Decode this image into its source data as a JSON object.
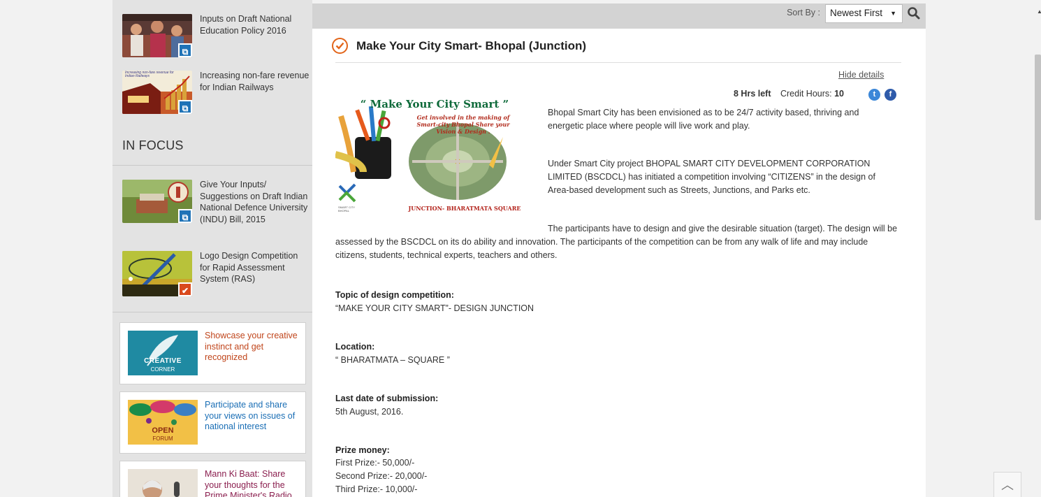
{
  "sidebar": {
    "items_top": [
      {
        "label": "Inputs on Draft National Education Policy 2016"
      },
      {
        "label": "Increasing non-fare revenue for Indian Railways"
      }
    ],
    "in_focus_heading": "IN FOCUS",
    "items_focus": [
      {
        "label": "Give Your Inputs/ Suggestions on Draft Indian National Defence University (INDU) Bill, 2015"
      },
      {
        "label": "Logo Design Competition for Rapid Assessment System (RAS)"
      }
    ],
    "promos": [
      {
        "label": "Showcase your creative instinct and get recognized",
        "image_text": "CREATIVE",
        "image_sub": "CORNER",
        "color": "#c0451b"
      },
      {
        "label": "Participate and share your views on issues of national interest",
        "image_text": "OPEN",
        "image_sub": "FORUM",
        "color": "#1a6eb5"
      },
      {
        "label": "Mann Ki Baat: Share your thoughts for the Prime Minister's Radio",
        "color": "#8a1e4e"
      }
    ],
    "thumb_text": "Increasing non-fare revenue for Indian Railways"
  },
  "toolbar": {
    "sort_label": "Sort By :",
    "sort_value": "Newest First"
  },
  "task": {
    "title": "Make Your City Smart- Bhopal (Junction)",
    "hide_details": "Hide details",
    "time_left": "8 Hrs left",
    "credit_label": "Credit Hours:",
    "credit_value": "10",
    "poster": {
      "title": "“ Make Your City Smart ”",
      "sub": "Get involved in the making of Smart-city Bhopal Share your Vision & Design .",
      "junction": "JUNCTION- BHARATMATA SQUARE",
      "logo_text": "SMART CITY BHOPAL"
    },
    "paragraph1": "Bhopal Smart City has been envisioned as to be 24/7 activity based, thriving and energetic place where people will live work and play.",
    "paragraph2": "Under Smart City project BHOPAL SMART CITY DEVELOPMENT CORPORATION LIMITED (BSCDCL) has initiated a competition involving “CITIZENS” in the design of Area-based development such as Streets, Junctions, and Parks etc.",
    "paragraph3": "The participants have to design and give the desirable situation (target). The design will be assessed by the BSCDCL on its do ability and innovation. The participants of the competition can be from any walk of life and may include citizens, students, technical experts, teachers and others.",
    "topic_label": "Topic of design competition:",
    "topic_value": "“MAKE YOUR CITY SMART”- DESIGN JUNCTION",
    "location_label": "Location:",
    "location_value": "“ BHARATMATA – SQUARE ”",
    "lastdate_label": "Last date of submission:",
    "lastdate_value": "5th August, 2016.",
    "prize_label": "Prize money:",
    "prizes": [
      "First Prize:- 50,000/-",
      "Second Prize:- 20,000/-",
      "Third Prize:- 10,000/-"
    ]
  }
}
